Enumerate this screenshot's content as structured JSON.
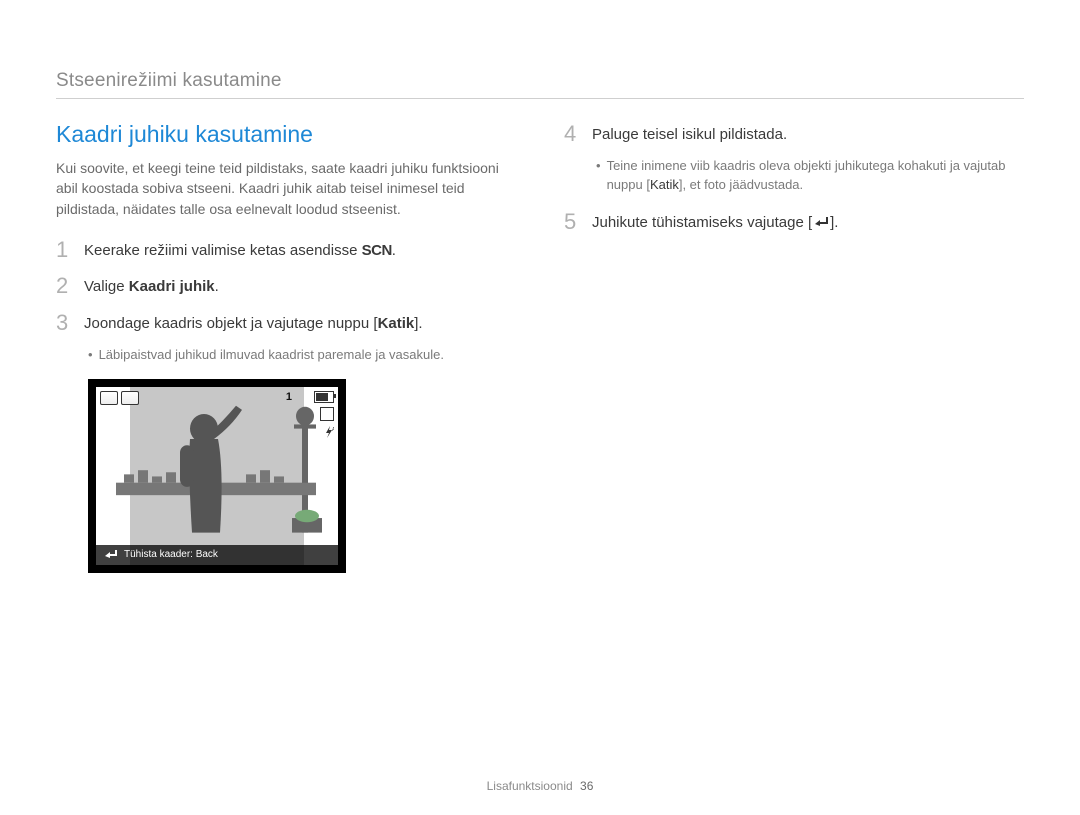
{
  "breadcrumb": "Stseenirežiimi kasutamine",
  "title": "Kaadri juhiku kasutamine",
  "intro": "Kui soovite, et keegi teine teid pildistaks, saate kaadri juhiku funktsiooni abil koostada sobiva stseeni. Kaadri juhik aitab teisel inimesel teid pildistada, näidates talle osa eelnevalt loodud stseenist.",
  "steps": {
    "s1": {
      "num": "1",
      "text_a": "Keerake režiimi valimise ketas asendisse ",
      "scn": "SCN",
      "text_b": "."
    },
    "s2": {
      "num": "2",
      "text_a": "Valige ",
      "bold": "Kaadri juhik",
      "text_b": "."
    },
    "s3": {
      "num": "3",
      "text_a": "Joondage kaadris objekt ja vajutage nuppu [",
      "bold": "Katik",
      "text_b": "]."
    },
    "s3_sub": "Läbipaistvad juhikud ilmuvad kaadrist paremale ja vasakule.",
    "s4": {
      "num": "4",
      "text": "Paluge teisel isikul pildistada."
    },
    "s4_sub_a": "Teine inimene viib kaadris oleva objekti juhikutega kohakuti ja vajutab nuppu [",
    "s4_sub_bold": "Katik",
    "s4_sub_b": "], et foto jäädvustada.",
    "s5": {
      "num": "5",
      "text_a": "Juhikute tühistamiseks vajutage [",
      "text_b": "]."
    }
  },
  "preview": {
    "count": "1",
    "strip_text": "Tühista kaader: Back"
  },
  "footer": {
    "label": "Lisafunktsioonid",
    "page": "36"
  }
}
